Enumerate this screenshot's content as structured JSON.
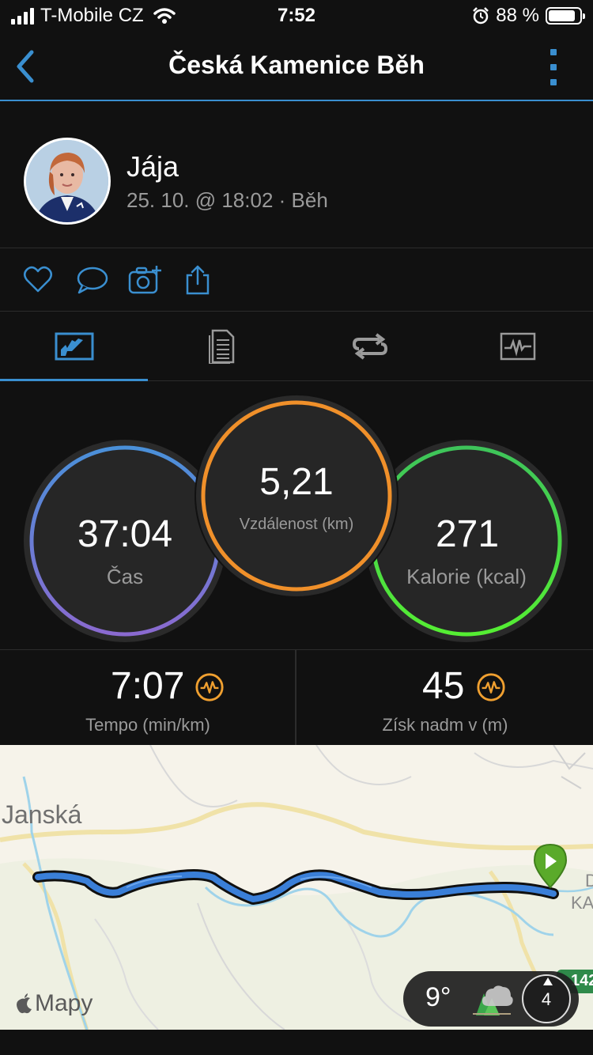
{
  "status_bar": {
    "carrier": "T-Mobile CZ",
    "time": "7:52",
    "battery_percent": "88 %",
    "battery_level": 0.88
  },
  "nav": {
    "title": "Česká Kamenice Běh"
  },
  "profile": {
    "name": "Jája",
    "subtitle": "25. 10. @ 18:02 · Běh"
  },
  "actions": [
    "heart-icon",
    "comment-icon",
    "camera-add-icon",
    "share-icon"
  ],
  "tabs": [
    "overview-chart-icon",
    "details-document-icon",
    "laps-loop-icon",
    "activity-graph-icon"
  ],
  "stats": {
    "time": {
      "value": "37:04",
      "label": "Čas"
    },
    "distance": {
      "value": "5,21",
      "label": "Vzdálenost (km)"
    },
    "calories": {
      "value": "271",
      "label": "Kalorie (kcal)"
    }
  },
  "metrics": {
    "pace": {
      "value": "7:07",
      "label": "Tempo (min/km)"
    },
    "elevation": {
      "value": "45",
      "label": "Získ nadm v (m)"
    }
  },
  "map": {
    "town_left": "Janská",
    "town_right_line1": "D",
    "town_right_line2": "KA",
    "road_number": "142",
    "logo_text": "Mapy",
    "weather_temp": "9°",
    "compass_value": "4"
  },
  "colors": {
    "accent": "#3a8fd0",
    "time_ring_start": "#4a90d9",
    "time_ring_end": "#8a6ad0",
    "distance_ring": "#f0902a",
    "calories_ring": "#44dd44",
    "badge": "#f0a030",
    "route": "#3a7fd8",
    "finish_marker": "#5aaa2a"
  }
}
